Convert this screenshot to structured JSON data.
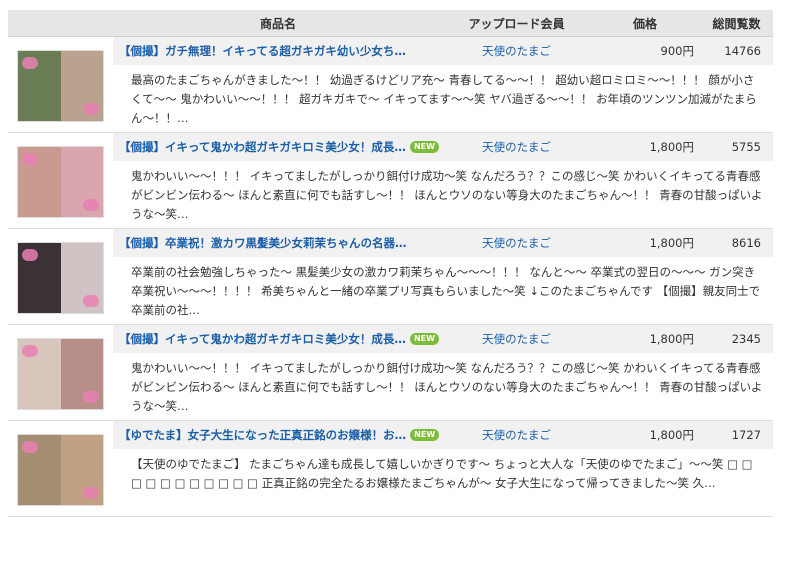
{
  "header": {
    "name": "商品名",
    "uploader": "アップロード会員",
    "price": "価格",
    "views": "総閲覧数"
  },
  "items": [
    {
      "title": "【個撮】ガチ無理！イキってる超ガキガキ幼い少女ち…",
      "is_new": false,
      "uploader": "天使のたまご",
      "price": "900円",
      "views": "14766",
      "description": "最高のたまごちゃんがきました〜！！ 幼過ぎるけどリア充〜 青春してる〜〜！！ 超幼い超ロミロミ〜〜！！！ 顔が小さくて〜〜 鬼かわいい〜〜！！！ 超ガキガキで〜 イキってます〜〜笑 ヤバ過ぎる〜〜！！ お年頃のツンツン加減がたまらん〜！！…"
    },
    {
      "title": "【個撮】イキって鬼かわ超ガキガキロミ美少女！成長…",
      "is_new": true,
      "uploader": "天使のたまご",
      "price": "1,800円",
      "views": "5755",
      "description": "鬼かわいい〜〜！！！ イキってましたがしっかり餌付け成功〜笑 なんだろう？？この感じ〜笑 かわいくイキってる青春感がビンビン伝わる〜 ほんと素直に何でも話すし〜！！ ほんとウソのない等身大のたまごちゃん〜！！ 青春の甘酸っぱいような〜笑…"
    },
    {
      "title": "【個撮】卒業祝！激カワ黒髪美少女莉茉ちゃんの名器…",
      "is_new": false,
      "uploader": "天使のたまご",
      "price": "1,800円",
      "views": "8616",
      "description": "卒業前の社会勉強しちゃった〜 黒髪美少女の激カワ莉茉ちゃん〜〜〜！！！ なんと〜〜 卒業式の翌日の〜〜〜 ガン突き卒業祝い〜〜〜！！！！ 希美ちゃんと一緒の卒業プリ写真もらいました〜笑 ↓このたまごちゃんです 【個撮】親友同士で卒業前の社…"
    },
    {
      "title": "【個撮】イキって鬼かわ超ガキガキロミ美少女！成長…",
      "is_new": true,
      "uploader": "天使のたまご",
      "price": "1,800円",
      "views": "2345",
      "description": "鬼かわいい〜〜！！！ イキってましたがしっかり餌付け成功〜笑 なんだろう？？この感じ〜笑 かわいくイキってる青春感がビンビン伝わる〜 ほんと素直に何でも話すし〜！！ ほんとウソのない等身大のたまごちゃん〜！！ 青春の甘酸っぱいような〜笑…"
    },
    {
      "title": "【ゆでたま】女子大生になった正真正銘のお嬢様！お…",
      "is_new": true,
      "uploader": "天使のたまご",
      "price": "1,800円",
      "views": "1727",
      "description": "【天使のゆでたまご】 たまごちゃん達も成長して嬉しいかぎりです〜 ちょっと大人な「天使のゆでたまご」〜〜笑 □ □ □ □ □ □ □ □ □ □ □ 正真正銘の完全たるお嬢様たまごちゃんが〜 女子大生になって帰ってきました〜笑 久…"
    }
  ],
  "new_badge": "NEW",
  "colors": {
    "header_bg": "#e6e6e6",
    "title_row_bg": "#f1f1f1",
    "link": "#1a5fa8",
    "new_badge": "#7dbb3a"
  }
}
